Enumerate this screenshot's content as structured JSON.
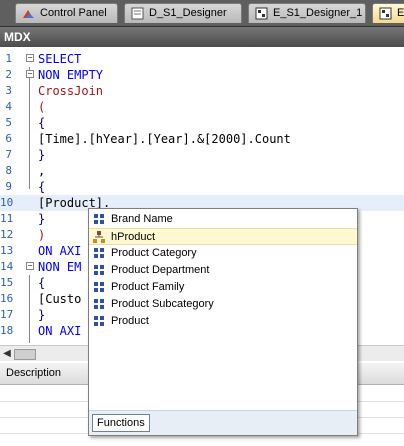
{
  "tabs": [
    {
      "label": "Control Panel",
      "icon": "control-panel-icon"
    },
    {
      "label": "D_S1_Designer",
      "icon": "document-icon"
    },
    {
      "label": "E_S1_Designer_1",
      "icon": "designer-icon"
    },
    {
      "label": "E",
      "icon": "designer-icon"
    }
  ],
  "editor": {
    "title": "MDX",
    "lines": [
      {
        "num": "1",
        "text": "SELECT"
      },
      {
        "num": "2",
        "text": "NON EMPTY"
      },
      {
        "num": "3",
        "text": "CrossJoin"
      },
      {
        "num": "4",
        "text": "("
      },
      {
        "num": "5",
        "text": "{"
      },
      {
        "num": "6",
        "text": "[Time].[hYear].[Year].&[2000].Count"
      },
      {
        "num": "7",
        "text": "}"
      },
      {
        "num": "8",
        "text": ","
      },
      {
        "num": "9",
        "text": "{"
      },
      {
        "num": "10",
        "text": "[Product]."
      },
      {
        "num": "11",
        "text": "}"
      },
      {
        "num": "12",
        "text": ")"
      },
      {
        "num": "13",
        "text": "ON AXI"
      },
      {
        "num": "14",
        "text": "NON EM"
      },
      {
        "num": "15",
        "text": "{"
      },
      {
        "num": "16",
        "text": "[Custo"
      },
      {
        "num": "17",
        "text": "}"
      },
      {
        "num": "18",
        "text": "ON AXI"
      }
    ]
  },
  "autocomplete": {
    "items": [
      {
        "label": "Brand Name",
        "icon": "level-icon"
      },
      {
        "label": "hProduct",
        "icon": "hierarchy-icon",
        "selected": true
      },
      {
        "label": "Product Category",
        "icon": "level-icon"
      },
      {
        "label": "Product Department",
        "icon": "level-icon"
      },
      {
        "label": "Product Family",
        "icon": "level-icon"
      },
      {
        "label": "Product Subcategory",
        "icon": "level-icon"
      },
      {
        "label": "Product",
        "icon": "level-icon"
      }
    ],
    "footer_button": "Functions"
  },
  "description": {
    "label": "Description"
  },
  "colors": {
    "keyword": "#0000ff",
    "function": "#a31515",
    "line_numbers": "#2b5fb4",
    "selected_item": "#fff8d0"
  }
}
